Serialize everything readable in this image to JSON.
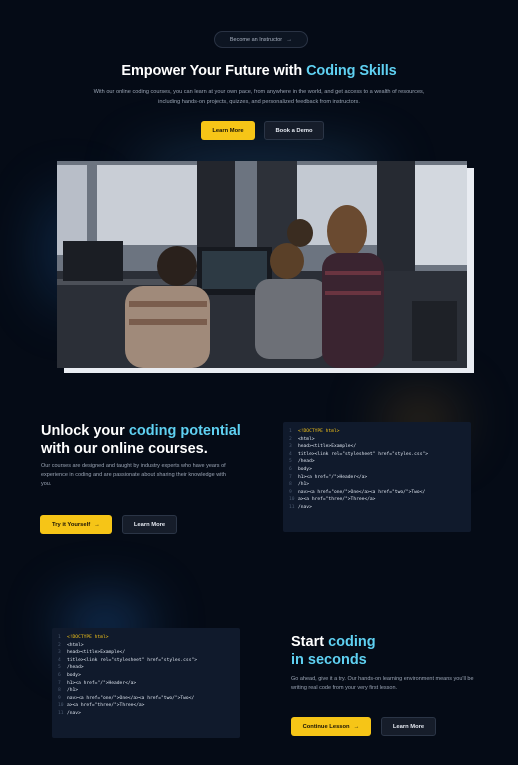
{
  "hero": {
    "badge": "Become an Instructor",
    "title_main": "Empower Your Future with ",
    "title_accent": "Coding Skills",
    "description": "With our online coding courses, you can learn at your own pace, from anywhere in the world, and get access to a wealth of resources, including hands-on projects, quizzes, and personalized feedback from instructors.",
    "primary_label": "Learn More",
    "secondary_label": "Book a Demo"
  },
  "section_unlock": {
    "title_1": "Unlock your ",
    "title_accent": "coding potential",
    "title_2": "with our online courses.",
    "description": "Our courses are designed and taught by industry experts who have years of experience in coding and are passionate about sharing their knowledge with you.",
    "primary_label": "Try it Yourself",
    "secondary_label": "Learn More"
  },
  "section_start": {
    "title_1": "Start ",
    "title_accent": "coding",
    "title_2": "in seconds",
    "description": "Go ahead, give it a try. Our hands-on learning environment means you'll be writing real code from your very first lesson.",
    "primary_label": "Continue Lesson",
    "secondary_label": "Learn More"
  },
  "code_lines": [
    "<!DOCTYPE html>",
    "<html>",
    "head><title>Example</",
    "title><link rel=\"stylesheet\" href=\"styles.css\">",
    "/head>",
    "body>",
    "h1><a href=\"/\">Header</a>",
    "/h1>",
    "nav><a href=\"one/\">One</a><a href=\"two/\">Two</",
    "a><a href=\"three/\">Three</a>",
    "/nav>"
  ],
  "colors": {
    "background": "#050b16",
    "accent": "#5fd1f2",
    "cta": "#f6c517"
  },
  "icons": {
    "arrow": "→"
  }
}
